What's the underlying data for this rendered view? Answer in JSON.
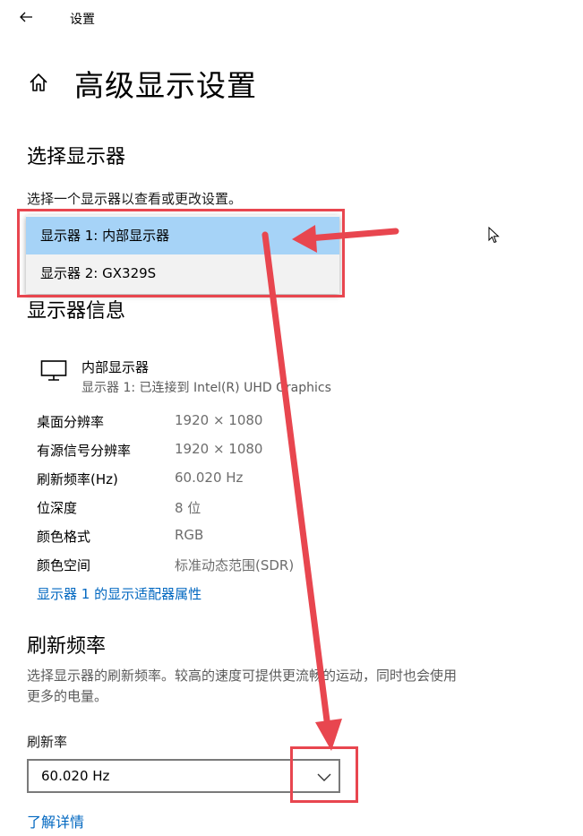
{
  "app": {
    "title": "设置",
    "back_icon": "back-arrow-icon"
  },
  "page": {
    "title": "高级显示设置",
    "home_icon": "home-icon"
  },
  "select_display": {
    "heading": "选择显示器",
    "description": "选择一个显示器以查看或更改设置。",
    "options": [
      "显示器 1: 内部显示器",
      "显示器 2: GX329S"
    ],
    "selected_index": 0
  },
  "display_info": {
    "heading": "显示器信息",
    "monitor_icon": "monitor-icon",
    "name": "内部显示器",
    "subtitle": "显示器 1: 已连接到 Intel(R) UHD Graphics",
    "rows": [
      {
        "label": "桌面分辨率",
        "value": "1920 × 1080"
      },
      {
        "label": "有源信号分辨率",
        "value": "1920 × 1080"
      },
      {
        "label": "刷新频率(Hz)",
        "value": "60.020 Hz"
      },
      {
        "label": "位深度",
        "value": "8 位"
      },
      {
        "label": "颜色格式",
        "value": "RGB"
      },
      {
        "label": "颜色空间",
        "value": "标准动态范围(SDR)"
      }
    ],
    "adapter_link": "显示器 1 的显示适配器属性"
  },
  "refresh_rate": {
    "heading": "刷新频率",
    "description_line1": "选择显示器的刷新频率。较高的速度可提供更流畅的运动，同时也会使用",
    "description_line2": "更多的电量。",
    "field_label": "刷新率",
    "selected_value": "60.020 Hz",
    "chevron_icon": "chevron-down-icon"
  },
  "learn_more": "了解详情",
  "colors": {
    "accent": "#0067c0",
    "selection": "#a6d3f7",
    "annotation": "#e8464f"
  }
}
